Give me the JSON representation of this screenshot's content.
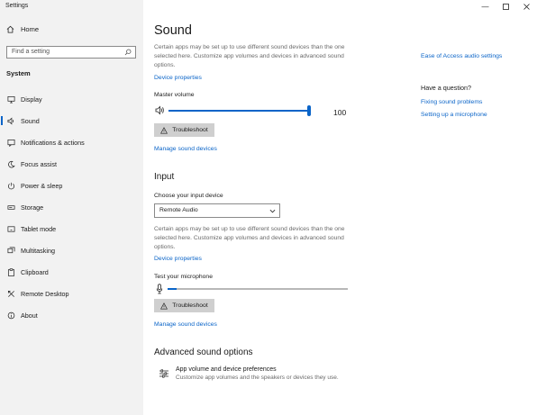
{
  "window": {
    "title": "Settings"
  },
  "sidebar": {
    "home_label": "Home",
    "search_placeholder": "Find a setting",
    "group_label": "System",
    "items": [
      {
        "label": "Display",
        "icon": "monitor-icon"
      },
      {
        "label": "Sound",
        "icon": "speaker-icon",
        "active": true
      },
      {
        "label": "Notifications & actions",
        "icon": "notification-icon"
      },
      {
        "label": "Focus assist",
        "icon": "moon-icon"
      },
      {
        "label": "Power & sleep",
        "icon": "power-icon"
      },
      {
        "label": "Storage",
        "icon": "storage-icon"
      },
      {
        "label": "Tablet mode",
        "icon": "tablet-icon"
      },
      {
        "label": "Multitasking",
        "icon": "multitasking-icon"
      },
      {
        "label": "Clipboard",
        "icon": "clipboard-icon"
      },
      {
        "label": "Remote Desktop",
        "icon": "remote-desktop-icon"
      },
      {
        "label": "About",
        "icon": "info-icon"
      }
    ]
  },
  "main": {
    "title": "Sound",
    "output_desc": "Certain apps may be set up to use different sound devices than the one selected here. Customize app volumes and devices in advanced sound options.",
    "output_device_properties": "Device properties",
    "master_volume_label": "Master volume",
    "master_volume_value": "100",
    "master_volume_fraction": 1.0,
    "troubleshoot_label": "Troubleshoot",
    "manage_devices": "Manage sound devices",
    "input_heading": "Input",
    "input_device_label": "Choose your input device",
    "input_device_value": "Remote Audio",
    "input_desc": "Certain apps may be set up to use different sound devices than the one selected here. Customize app volumes and devices in advanced sound options.",
    "input_device_properties": "Device properties",
    "mic_test_label": "Test your microphone",
    "mic_level_fraction": 0.05,
    "input_troubleshoot_label": "Troubleshoot",
    "input_manage_devices": "Manage sound devices",
    "advanced_heading": "Advanced sound options",
    "app_volume_title": "App volume and device preferences",
    "app_volume_desc": "Customize app volumes and the speakers or devices they use."
  },
  "related": {
    "ease_of_access": "Ease of Access audio settings",
    "question_heading": "Have a question?",
    "links": [
      "Fixing sound problems",
      "Setting up a microphone"
    ]
  },
  "colors": {
    "accent": "#0a64c8",
    "sidebar_bg": "#f2f2f2"
  }
}
